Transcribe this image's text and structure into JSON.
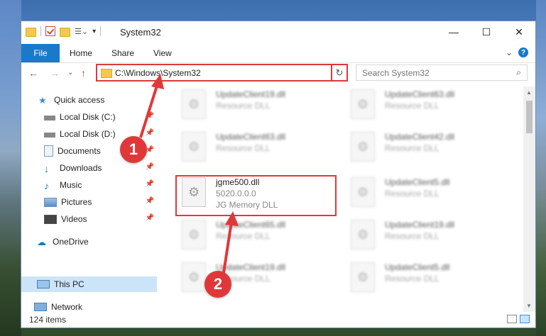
{
  "window": {
    "title": "System32",
    "minimize_label": "—",
    "maximize_label": "☐",
    "close_label": "✕"
  },
  "ribbon": {
    "tabs": [
      "File",
      "Home",
      "Share",
      "View"
    ],
    "collapse_label": "⌄",
    "help_label": "?"
  },
  "address": {
    "path": "C:\\Windows\\System32",
    "back_label": "←",
    "forward_label": "→",
    "recent_label": "⌄",
    "up_label": "↑",
    "dropdown_label": "⌄",
    "refresh_label": "↻"
  },
  "search": {
    "placeholder": "Search System32",
    "icon_label": "⌕"
  },
  "nav": {
    "items": [
      {
        "label": "Quick access",
        "icon": "star-icon"
      },
      {
        "label": "Local Disk (C:)",
        "icon": "drive-icon",
        "pinned": true
      },
      {
        "label": "Local Disk (D:)",
        "icon": "drive-icon",
        "pinned": true
      },
      {
        "label": "Documents",
        "icon": "documents-icon",
        "pinned": true
      },
      {
        "label": "Downloads",
        "icon": "download-icon",
        "pinned": true
      },
      {
        "label": "Music",
        "icon": "music-icon",
        "pinned": true
      },
      {
        "label": "Pictures",
        "icon": "pictures-icon",
        "pinned": true
      },
      {
        "label": "Videos",
        "icon": "videos-icon",
        "pinned": true
      },
      {
        "label": "OneDrive",
        "icon": "cloud-icon"
      },
      {
        "label": "This PC",
        "icon": "computer-icon",
        "selected": true
      },
      {
        "label": "Network",
        "icon": "network-icon"
      }
    ],
    "pin_label": "📌"
  },
  "files": {
    "col1": [
      {
        "name": "UpdateClient19.dll",
        "desc": "Resource DLL"
      },
      {
        "name": "UpdateClient63.dll",
        "desc": "Resource DLL"
      },
      {
        "name": "jgme500.dll",
        "desc": "5020.0.0.0",
        "desc2": "JG Memory DLL"
      },
      {
        "name": "UpdateClient65.dll",
        "desc": "Resource DLL"
      },
      {
        "name": "UpdateClient19.dll",
        "desc": "Resource DLL"
      }
    ],
    "col2": [
      {
        "name": "UpdateClient63.dll",
        "desc": "Resource DLL"
      },
      {
        "name": "UpdateClient42.dll",
        "desc": "Resource DLL"
      },
      {
        "name": "UpdateClient5.dll",
        "desc": "Resource DLL"
      },
      {
        "name": "UpdateClient19.dll",
        "desc": "Resource DLL"
      },
      {
        "name": "UpdateClient5.dll",
        "desc": "Resource DLL"
      }
    ]
  },
  "status": {
    "item_count": "124 items"
  },
  "markers": {
    "one": "1",
    "two": "2"
  },
  "colors": {
    "accent": "#1979ca",
    "highlight": "#e0383a",
    "selected_bg": "#cce4f7"
  }
}
